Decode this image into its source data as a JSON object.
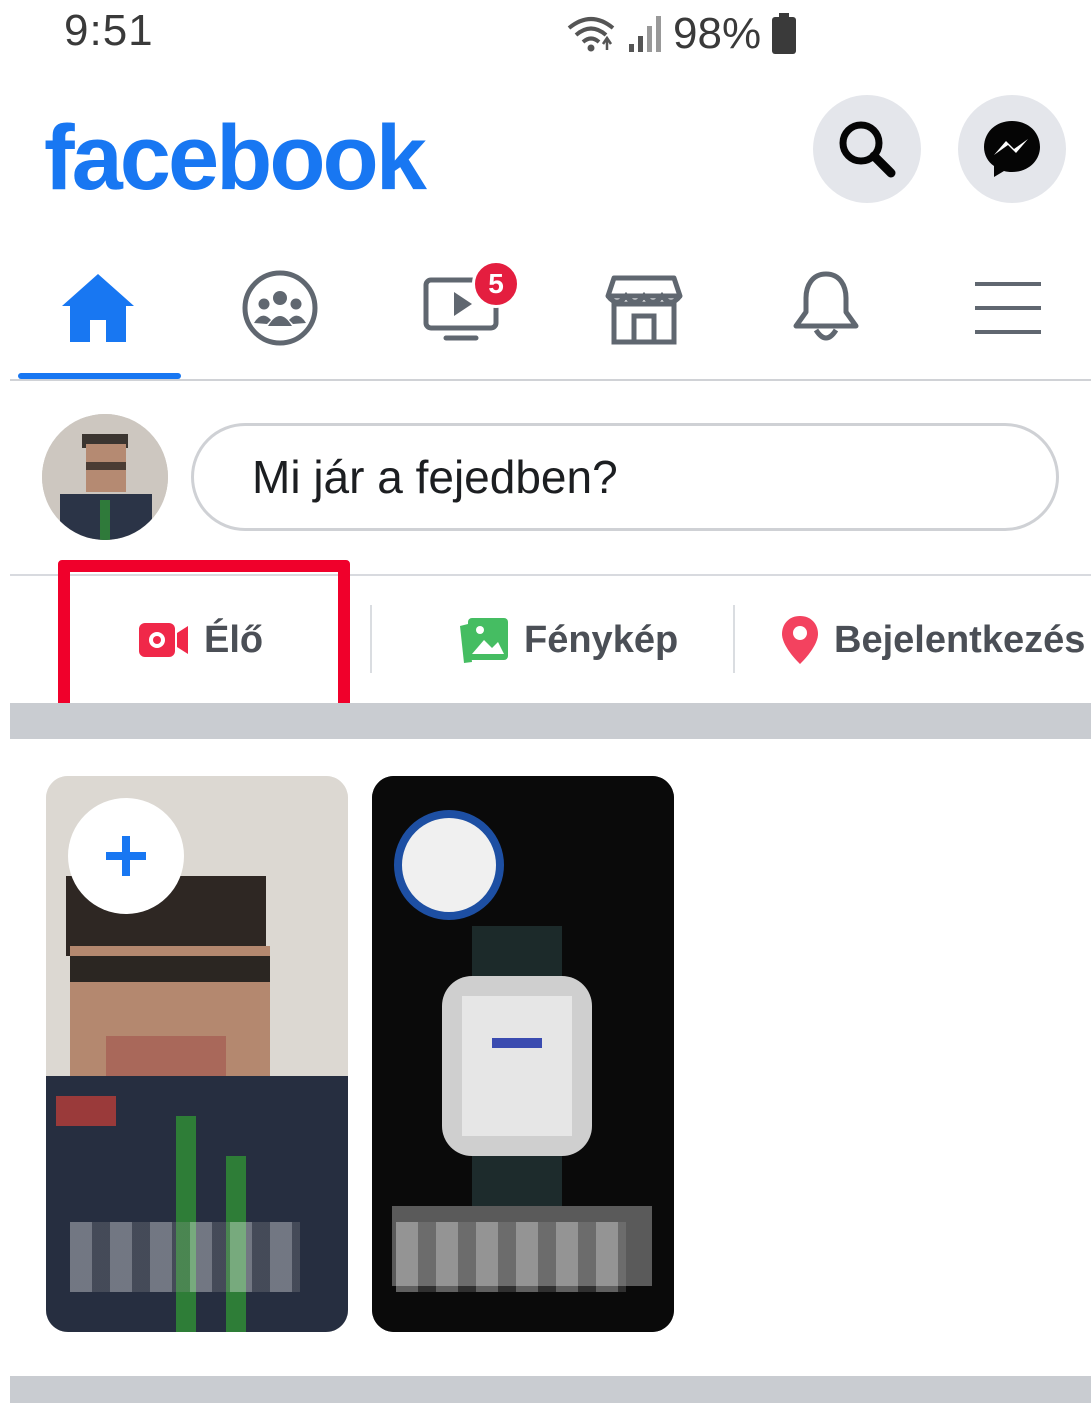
{
  "status_bar": {
    "time": "9:51",
    "battery": "98%",
    "icons": [
      "wifi-icon",
      "signal-icon",
      "battery-icon"
    ]
  },
  "header": {
    "logo": "facebook",
    "brand_color": "#1877f2",
    "actions": [
      "search-icon",
      "messenger-icon"
    ]
  },
  "nav": {
    "tabs": [
      {
        "name": "home",
        "icon": "home-icon",
        "active": true
      },
      {
        "name": "groups",
        "icon": "groups-icon"
      },
      {
        "name": "watch",
        "icon": "video-icon",
        "badge": "5"
      },
      {
        "name": "marketplace",
        "icon": "store-icon"
      },
      {
        "name": "notifications",
        "icon": "bell-icon"
      },
      {
        "name": "menu",
        "icon": "hamburger-icon"
      }
    ]
  },
  "composer": {
    "placeholder": "Mi jár a fejedben?"
  },
  "actions": {
    "live": "Élő",
    "photo": "Fénykép",
    "checkin": "Bejelentkezés"
  },
  "colors": {
    "highlight_box": "#f0002b",
    "live_icon": "#f02849",
    "photo_icon": "#45bd62",
    "checkin_icon": "#f3425f"
  }
}
